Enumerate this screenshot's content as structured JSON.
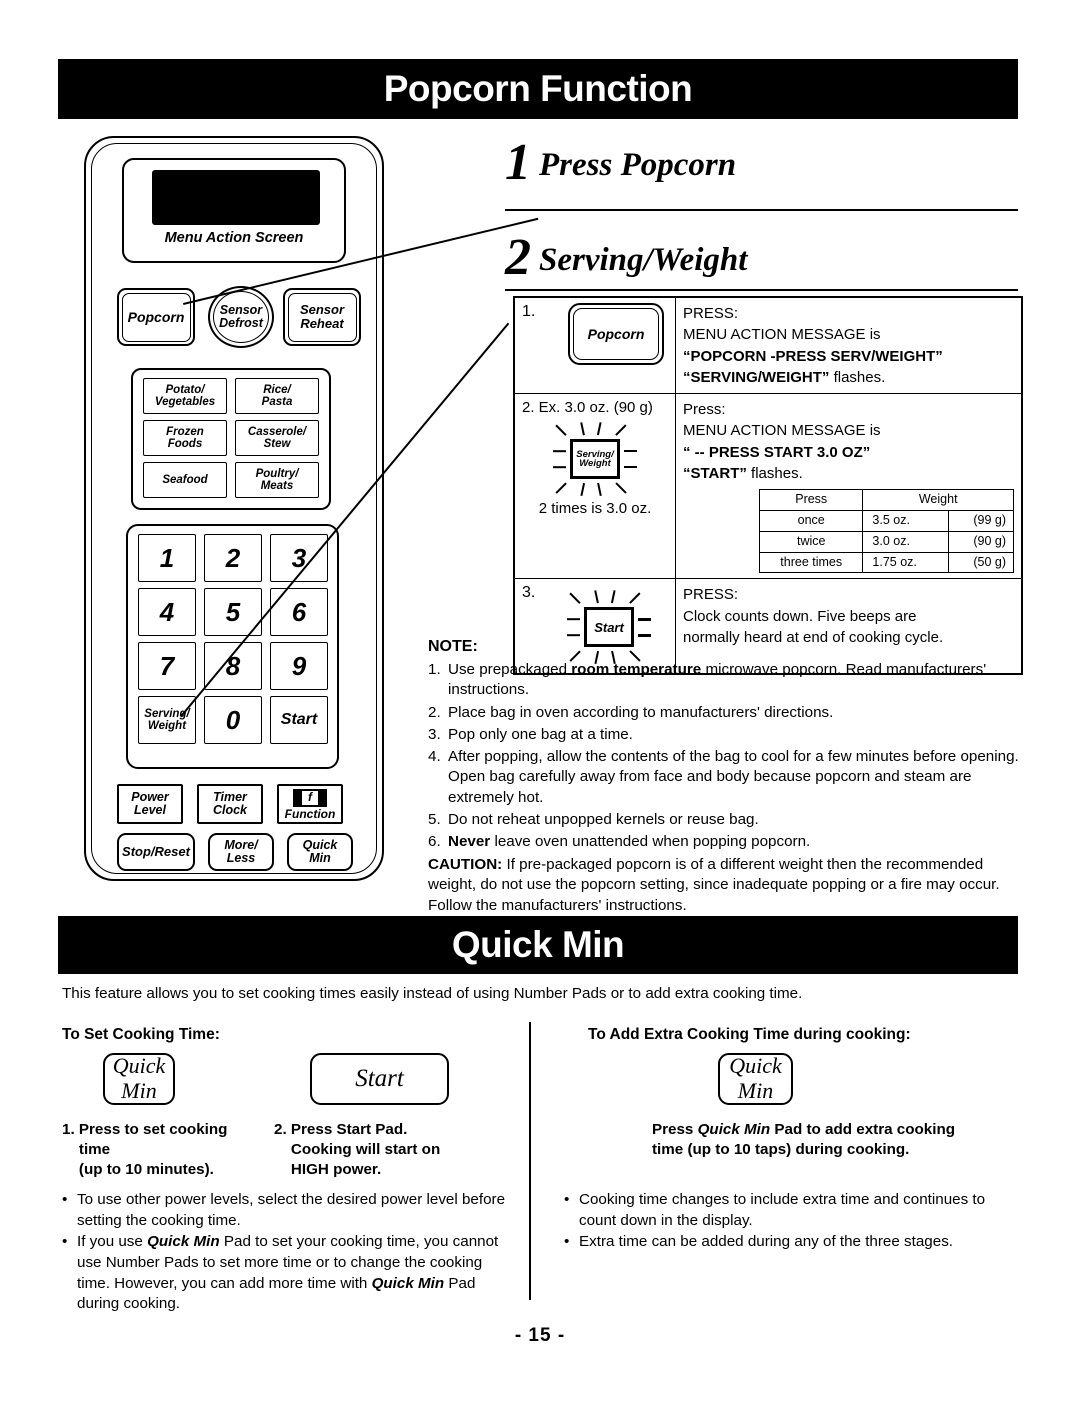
{
  "sections": {
    "popcorn_title": "Popcorn Function",
    "quickmin_title": "Quick Min"
  },
  "panel": {
    "screen_label": "Menu Action Screen",
    "popcorn": "Popcorn",
    "sensor_defrost_1": "Sensor",
    "sensor_defrost_2": "Defrost",
    "sensor_reheat_1": "Sensor",
    "sensor_reheat_2": "Reheat",
    "menu_buttons": [
      {
        "l1": "Potato/",
        "l2": "Vegetables"
      },
      {
        "l1": "Rice/",
        "l2": "Pasta"
      },
      {
        "l1": "Frozen",
        "l2": "Foods"
      },
      {
        "l1": "Casserole/",
        "l2": "Stew"
      },
      {
        "l1": "Seafood",
        "l2": ""
      },
      {
        "l1": "Poultry/",
        "l2": "Meats"
      }
    ],
    "numpad": [
      "1",
      "2",
      "3",
      "4",
      "5",
      "6",
      "7",
      "8",
      "9"
    ],
    "serving_weight_1": "Serving/",
    "serving_weight_2": "Weight",
    "zero": "0",
    "start": "Start",
    "power_1": "Power",
    "power_2": "Level",
    "timer_1": "Timer",
    "timer_2": "Clock",
    "function": "Function",
    "function_glyph": "f",
    "stop_reset": "Stop/Reset",
    "more_1": "More/",
    "more_2": "Less",
    "quick_1": "Quick",
    "quick_2": "Min"
  },
  "headings": {
    "step1_num": "1",
    "step1_text": "Press Popcorn",
    "step2_num": "2",
    "step2_text": "Serving/Weight"
  },
  "steps": {
    "row1": {
      "num": "1.",
      "button_label": "Popcorn",
      "line1": "PRESS:",
      "line2": "MENU ACTION MESSAGE is",
      "line3": "“POPCORN   -PRESS SERV/WEIGHT”",
      "line4_bold": "“SERVING/WEIGHT”",
      "line4_rest": " flashes."
    },
    "row2": {
      "num_and_ex": "2. Ex. 3.0 oz. (90 g)",
      "button_l1": "Serving/",
      "button_l2": "Weight",
      "caption": "2 times is 3.0 oz.",
      "line1": "Press:",
      "line2": "MENU ACTION MESSAGE is",
      "line3": "“ -- PRESS START 3.0 OZ”",
      "line4_bold": "“START”",
      "line4_rest": " flashes.",
      "weight_table": {
        "headers": [
          "Press",
          "Weight"
        ],
        "rows": [
          {
            "press": "once",
            "oz": "3.5 oz.",
            "g": "(99 g)"
          },
          {
            "press": "twice",
            "oz": "3.0 oz.",
            "g": "(90 g)"
          },
          {
            "press": "three times",
            "oz": "1.75 oz.",
            "g": "(50 g)"
          }
        ]
      }
    },
    "row3": {
      "num": "3.",
      "button_label": "Start",
      "line1": "PRESS:",
      "line2": "Clock counts down. Five beeps are",
      "line3": "normally heard at end of cooking cycle."
    }
  },
  "note": {
    "heading": "NOTE:",
    "items": [
      {
        "n": "1.",
        "pre": "Use prepackaged ",
        "bold": "room temperature",
        "post": " microwave popcorn. Read manufacturers' instructions."
      },
      {
        "n": "2.",
        "pre": "Place bag in oven according to manufacturers' directions.",
        "bold": "",
        "post": ""
      },
      {
        "n": "3.",
        "pre": "Pop only one bag at a time.",
        "bold": "",
        "post": ""
      },
      {
        "n": "4.",
        "pre": "After popping, allow the contents of the bag to cool for a few minutes before opening. Open bag carefully away from face and body because popcorn and steam are extremely hot.",
        "bold": "",
        "post": ""
      },
      {
        "n": "5.",
        "pre": "Do not reheat unpopped kernels or reuse bag.",
        "bold": "",
        "post": ""
      },
      {
        "n": "6.",
        "pre": "",
        "bold": "Never",
        "post": " leave oven unattended when popping popcorn."
      }
    ],
    "caution_label": "CAUTION:",
    "caution_text": " If pre-packaged popcorn is of a different weight then the recommended weight, do not use the popcorn setting, since inadequate popping or a fire may occur. Follow the manufacturers' instructions."
  },
  "quickmin": {
    "intro": "This feature allows you to set cooking times easily instead of using Number Pads or to add extra cooking time.",
    "left_heading": "To Set Cooking Time:",
    "right_heading": "To Add Extra Cooking Time during cooking:",
    "pad_quick": "Quick",
    "pad_min": "Min",
    "pad_start": "Start",
    "step1": "1. Press to set cooking\n    time\n    (up to 10 minutes).",
    "step2": "2. Press Start Pad.\n    Cooking will start on\n    HIGH power.",
    "right_pre": "Press ",
    "right_bold": "Quick Min",
    "right_post": " Pad to add extra cooking time (up to 10 taps) during cooking.",
    "left_bullets": [
      {
        "parts": [
          {
            "t": "To use other power levels, select the desired power level before setting the cooking time.",
            "b": false
          }
        ]
      },
      {
        "parts": [
          {
            "t": "If you use ",
            "b": false
          },
          {
            "t": "Quick Min",
            "b": true
          },
          {
            "t": " Pad to set your cooking time, you cannot use Number Pads to set more time or to change the cooking time. However, you can add more time with ",
            "b": false
          },
          {
            "t": "Quick Min",
            "b": true
          },
          {
            "t": " Pad during cooking.",
            "b": false
          }
        ]
      }
    ],
    "right_bullets": [
      {
        "parts": [
          {
            "t": "Cooking time changes to include extra time and continues to count down in the display.",
            "b": false
          }
        ]
      },
      {
        "parts": [
          {
            "t": "Extra time can be added during any of the three stages.",
            "b": false
          }
        ]
      }
    ]
  },
  "footer": {
    "page": "- 15 -"
  }
}
